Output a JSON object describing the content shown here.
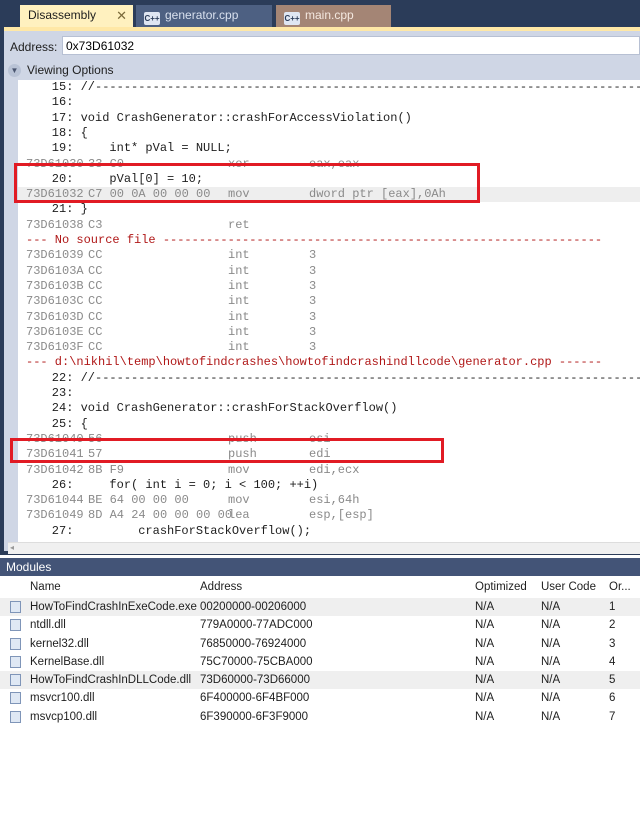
{
  "tabs": [
    {
      "label": "Disassembly",
      "active": true,
      "close": "✕"
    },
    {
      "label": "generator.cpp",
      "icon": "C++"
    },
    {
      "label": "main.cpp",
      "icon": "C++"
    }
  ],
  "address": {
    "label": "Address:",
    "value": "0x73D61032"
  },
  "viewing_options": "Viewing Options",
  "code_lines": [
    {
      "t": "src",
      "n": "    15: //-----------------------------------------------------------------------------------"
    },
    {
      "t": "src",
      "n": "    16:"
    },
    {
      "t": "src",
      "n": "    17: void CrashGenerator::crashForAccessViolation()"
    },
    {
      "t": "src",
      "n": "    18: {"
    },
    {
      "t": "src",
      "n": "    19:     int* pVal = NULL;"
    },
    {
      "t": "asm",
      "a": "73D61030",
      "b": "33 C0",
      "m": "xor",
      "o": "eax,eax"
    },
    {
      "t": "src",
      "n": "    20:     pVal[0] = 10;"
    },
    {
      "t": "asm",
      "a": "73D61032",
      "b": "C7 00 0A 00 00 00",
      "m": "mov",
      "o": "dword ptr [eax],0Ah",
      "cur": true
    },
    {
      "t": "src",
      "n": "    21: }"
    },
    {
      "t": "asm",
      "a": "73D61038",
      "b": "C3",
      "m": "ret",
      "o": ""
    },
    {
      "t": "hdr",
      "n": "--- No source file -------------------------------------------------------------"
    },
    {
      "t": "asm",
      "a": "73D61039",
      "b": "CC",
      "m": "int",
      "o": "3"
    },
    {
      "t": "asm",
      "a": "73D6103A",
      "b": "CC",
      "m": "int",
      "o": "3"
    },
    {
      "t": "asm",
      "a": "73D6103B",
      "b": "CC",
      "m": "int",
      "o": "3"
    },
    {
      "t": "asm",
      "a": "73D6103C",
      "b": "CC",
      "m": "int",
      "o": "3"
    },
    {
      "t": "asm",
      "a": "73D6103D",
      "b": "CC",
      "m": "int",
      "o": "3"
    },
    {
      "t": "asm",
      "a": "73D6103E",
      "b": "CC",
      "m": "int",
      "o": "3"
    },
    {
      "t": "asm",
      "a": "73D6103F",
      "b": "CC",
      "m": "int",
      "o": "3"
    },
    {
      "t": "hdr",
      "n": "--- d:\\nikhil\\temp\\howtofindcrashes\\howtofindcrashindllcode\\generator.cpp ------"
    },
    {
      "t": "src",
      "n": "    22: //-----------------------------------------------------------------------------------"
    },
    {
      "t": "src",
      "n": "    23:"
    },
    {
      "t": "src",
      "n": "    24: void CrashGenerator::crashForStackOverflow()"
    },
    {
      "t": "src",
      "n": "    25: {"
    },
    {
      "t": "asm",
      "a": "73D61040",
      "b": "56",
      "m": "push",
      "o": "esi"
    },
    {
      "t": "asm",
      "a": "73D61041",
      "b": "57",
      "m": "push",
      "o": "edi"
    },
    {
      "t": "asm",
      "a": "73D61042",
      "b": "8B F9",
      "m": "mov",
      "o": "edi,ecx"
    },
    {
      "t": "src",
      "n": "    26:     for( int i = 0; i < 100; ++i)"
    },
    {
      "t": "asm",
      "a": "73D61044",
      "b": "BE 64 00 00 00",
      "m": "mov",
      "o": "esi,64h"
    },
    {
      "t": "asm",
      "a": "73D61049",
      "b": "8D A4 24 00 00 00 00",
      "m": "lea",
      "o": "esp,[esp]"
    },
    {
      "t": "src",
      "n": "    27:         crashForStackOverflow();"
    }
  ],
  "modules": {
    "title": "Modules",
    "columns": [
      "Name",
      "Address",
      "Optimized",
      "User Code",
      "Or..."
    ],
    "rows": [
      {
        "name": "HowToFindCrashInExeCode.exe",
        "address": "00200000-00206000",
        "optimized": "N/A",
        "user_code": "N/A",
        "order": "1",
        "hl": true
      },
      {
        "name": "ntdll.dll",
        "address": "779A0000-77ADC000",
        "optimized": "N/A",
        "user_code": "N/A",
        "order": "2"
      },
      {
        "name": "kernel32.dll",
        "address": "76850000-76924000",
        "optimized": "N/A",
        "user_code": "N/A",
        "order": "3"
      },
      {
        "name": "KernelBase.dll",
        "address": "75C70000-75CBA000",
        "optimized": "N/A",
        "user_code": "N/A",
        "order": "4"
      },
      {
        "name": "HowToFindCrashInDLLCode.dll",
        "address": "73D60000-73D66000",
        "optimized": "N/A",
        "user_code": "N/A",
        "order": "5",
        "hl": true
      },
      {
        "name": "msvcr100.dll",
        "address": "6F400000-6F4BF000",
        "optimized": "N/A",
        "user_code": "N/A",
        "order": "6"
      },
      {
        "name": "msvcp100.dll",
        "address": "6F390000-6F3F9000",
        "optimized": "N/A",
        "user_code": "N/A",
        "order": "7"
      }
    ]
  },
  "colors": {
    "highlight_box": "#e11b24",
    "header_text": "#b01818",
    "active_tab": "#fff1bf"
  }
}
